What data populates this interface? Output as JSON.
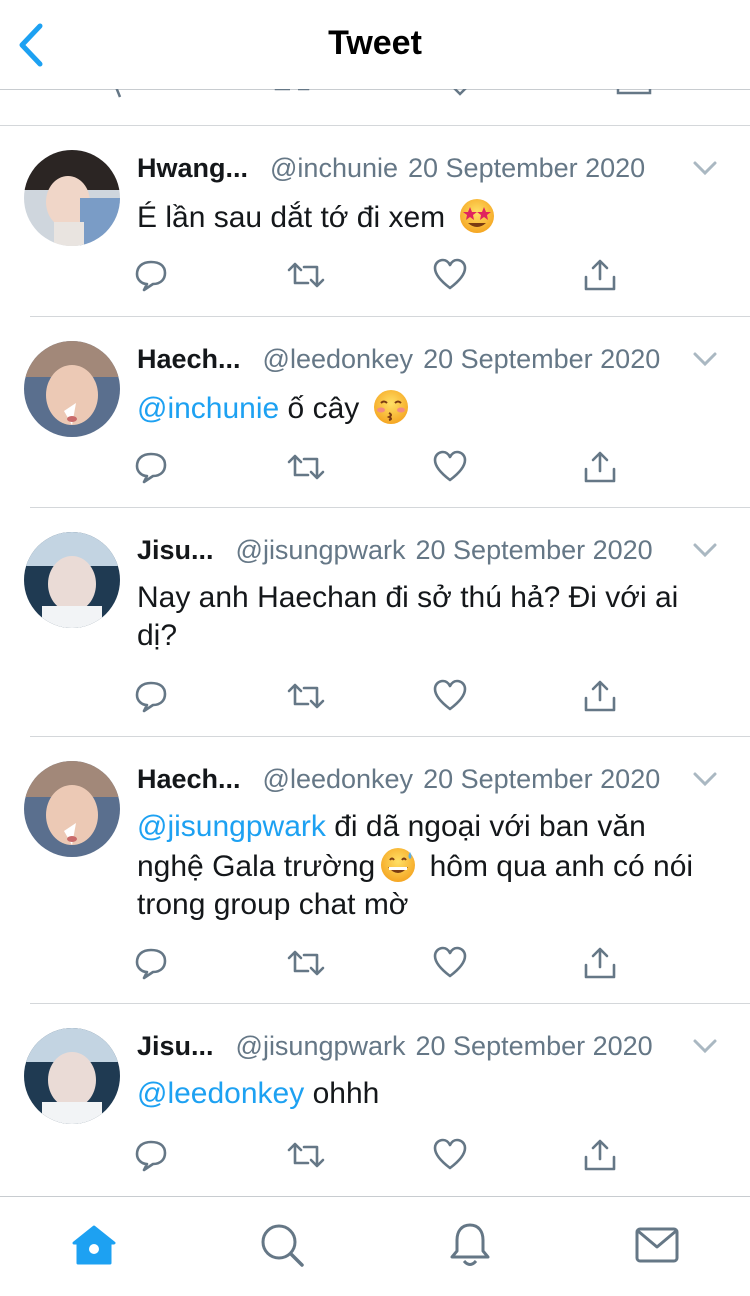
{
  "header": {
    "title": "Tweet",
    "back_icon": "chevron-left-icon",
    "accent_color": "#1da1f2"
  },
  "tweets": [
    {
      "name": "Hwang...",
      "handle": "@inchunie",
      "date": "20 September 2020",
      "mention": "",
      "text": "É lần sau dắt tớ đi xem",
      "text_after": "",
      "emoji": "star-struck-emoji"
    },
    {
      "name": "Haech...",
      "handle": "@leedonkey",
      "date": "20 September 2020",
      "mention": "@inchunie",
      "text": " ố cây",
      "text_after": "",
      "emoji": "kissing-face-emoji"
    },
    {
      "name": "Jisu...",
      "handle": "@jisungpwark",
      "date": "20 September 2020",
      "mention": "",
      "text": "Nay anh Haechan đi sở thú hả? Đi với ai dị?",
      "text_after": "",
      "emoji": ""
    },
    {
      "name": "Haech...",
      "handle": "@leedonkey",
      "date": "20 September 2020",
      "mention": "@jisungpwark",
      "text": " đi dã ngoại với ban văn nghệ Gala trường",
      "text_after": " hôm qua anh có nói trong group chat mờ",
      "emoji": "grinning-sweat-emoji"
    },
    {
      "name": "Jisu...",
      "handle": "@jisungpwark",
      "date": "20 September 2020",
      "mention": "@leedonkey",
      "text": " ohhh",
      "text_after": "",
      "emoji": ""
    }
  ],
  "actions": [
    "reply-icon",
    "retweet-icon",
    "like-icon",
    "share-icon"
  ],
  "tabbar": [
    "home-icon",
    "search-icon",
    "notifications-icon",
    "messages-icon"
  ]
}
